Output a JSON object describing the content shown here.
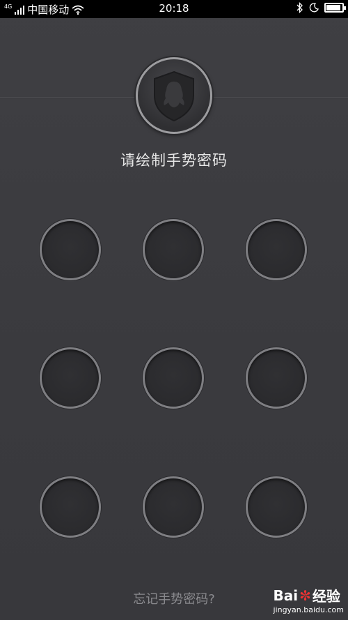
{
  "status_bar": {
    "signal_label": "4G",
    "carrier": "中国移动",
    "time": "20:18",
    "battery_level": 0.9
  },
  "lock_screen": {
    "prompt": "请绘制手势密码",
    "forgot_link": "忘记手势密码?",
    "grid_rows": 3,
    "grid_cols": 3
  },
  "watermark": {
    "logo_text_left": "Bai",
    "logo_text_right": "经验",
    "url": "jingyan.baidu.com"
  }
}
